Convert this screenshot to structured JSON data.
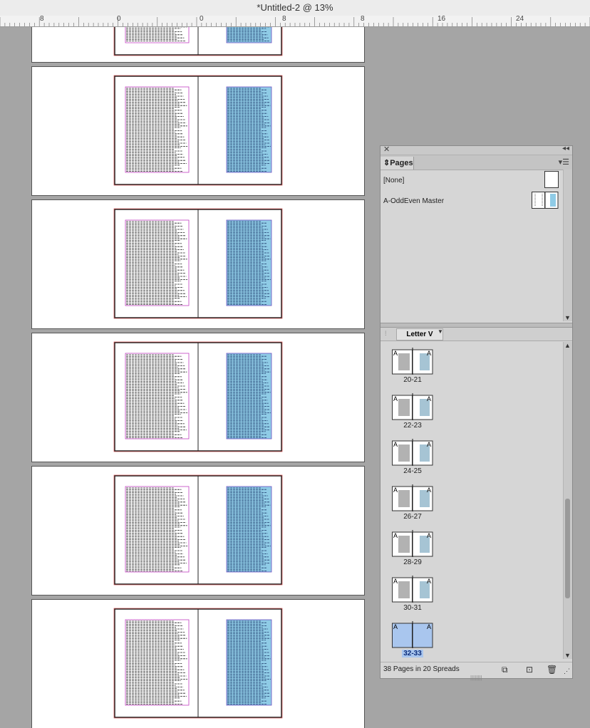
{
  "window": {
    "title": "*Untitled-2 @ 13%"
  },
  "ruler": {
    "labels": [
      "8",
      "0",
      "0",
      "8",
      "16",
      "24"
    ]
  },
  "pages_panel": {
    "tab_label": "Pages",
    "masters": [
      {
        "label": "[None]"
      },
      {
        "label": "A-OddEven Master"
      }
    ],
    "page_size": "Letter V",
    "spreads": [
      {
        "label": "20-21",
        "selected": false
      },
      {
        "label": "22-23",
        "selected": false
      },
      {
        "label": "24-25",
        "selected": false
      },
      {
        "label": "26-27",
        "selected": false
      },
      {
        "label": "28-29",
        "selected": false
      },
      {
        "label": "30-31",
        "selected": false
      },
      {
        "label": "32-33",
        "selected": true
      }
    ],
    "master_prefix": "A",
    "status": "38 Pages in 20 Spreads",
    "icons": [
      "edit-page-size-icon",
      "new-page-icon",
      "delete-page-icon"
    ]
  },
  "colors": {
    "column_blue": "#8fcbe6",
    "margin_magenta": "#c040c0",
    "selection_highlight": "#a9c6ee"
  }
}
